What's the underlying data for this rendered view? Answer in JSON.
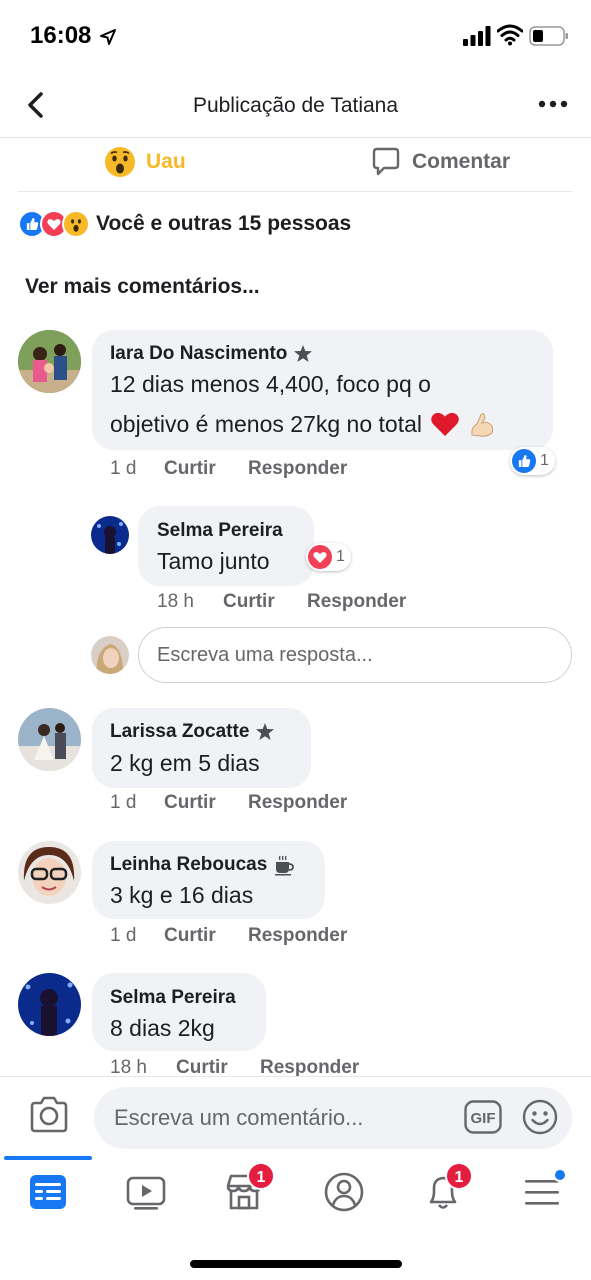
{
  "status": {
    "time": "16:08"
  },
  "header": {
    "title": "Publicação de Tatiana"
  },
  "actions": {
    "uau_label": "Uau",
    "comment_label": "Comentar"
  },
  "reactions_summary": {
    "text": "Você e outras 15 pessoas"
  },
  "more_comments": "Ver mais comentários...",
  "comments": [
    {
      "name": "Iara Do Nascimento",
      "text_line1": "12 dias menos 4,400, foco pq o",
      "text_line2": "objetivo é menos 27kg no total",
      "time": "1 d",
      "like": "Curtir",
      "reply": "Responder",
      "reaction_count": "1"
    },
    {
      "name": "Selma Pereira",
      "text": "Tamo junto",
      "time": "18 h",
      "like": "Curtir",
      "reply": "Responder",
      "reaction_count": "1"
    },
    {
      "name": "Larissa Zocatte",
      "text": "2 kg em 5 dias",
      "time": "1 d",
      "like": "Curtir",
      "reply": "Responder"
    },
    {
      "name": "Leinha Reboucas",
      "text": "3 kg e 16 dias",
      "time": "1 d",
      "like": "Curtir",
      "reply": "Responder"
    },
    {
      "name": "Selma Pereira",
      "text": "8 dias 2kg",
      "time": "18 h",
      "like": "Curtir",
      "reply": "Responder"
    }
  ],
  "reply_input": {
    "placeholder": "Escreva uma resposta..."
  },
  "composer": {
    "placeholder": "Escreva um comentário...",
    "gif_label": "GIF"
  },
  "tabbar": {
    "marketplace_badge": "1",
    "notifications_badge": "1"
  },
  "colors": {
    "accent": "#1877f2",
    "badge": "#e41e3f",
    "uau": "#f7b928"
  }
}
